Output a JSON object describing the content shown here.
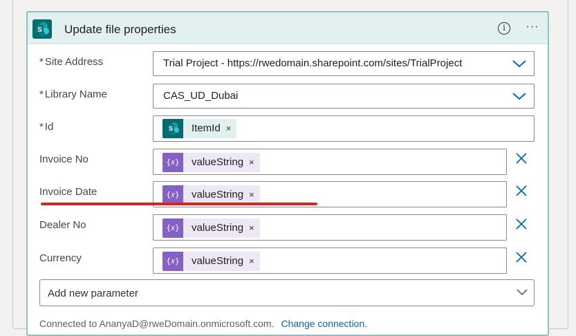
{
  "card": {
    "title": "Update file properties",
    "info_icon": "info-icon",
    "more_icon": "more-options-icon"
  },
  "fields": {
    "site_address": {
      "required": "*",
      "label": "Site Address",
      "value": "Trial Project - https://rwedomain.sharepoint.com/sites/TrialProject"
    },
    "library_name": {
      "required": "*",
      "label": "Library Name",
      "value": "CAS_UD_Dubai"
    },
    "id": {
      "required": "*",
      "label": "Id",
      "token": "ItemId",
      "token_icon": "sharepoint-icon"
    },
    "invoice_no": {
      "label": "Invoice No",
      "token": "valueString",
      "token_icon": "expression-icon"
    },
    "invoice_date": {
      "label": "Invoice Date",
      "token": "valueString",
      "token_icon": "expression-icon"
    },
    "dealer_no": {
      "label": "Dealer No",
      "token": "valueString",
      "token_icon": "expression-icon"
    },
    "currency": {
      "label": "Currency",
      "token": "valueString",
      "token_icon": "expression-icon"
    }
  },
  "token_remove_glyph": "×",
  "add_parameter": {
    "label": "Add new parameter"
  },
  "footer": {
    "connected_text": "Connected to AnanyaD@rweDomain.onmicrosoft.com.",
    "change_link": "Change connection."
  },
  "colors": {
    "sharepoint": "#036c70",
    "expression": "#8661c5",
    "header_bg": "#e3f0f0",
    "card_border": "#8cc1c3",
    "required": "#a4262c",
    "accent_blue": "#0067b8",
    "annotation_red": "#e0201e"
  }
}
